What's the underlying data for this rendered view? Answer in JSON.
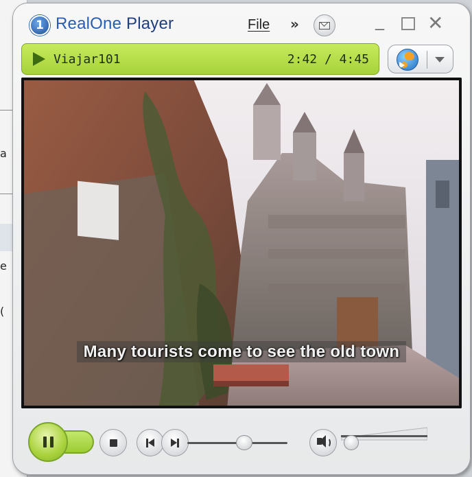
{
  "background_window": {
    "fragments": [
      "a",
      "e",
      "("
    ]
  },
  "player": {
    "title_brand": "RealOne",
    "title_rest": " Player",
    "logo_glyph": "1",
    "menu": {
      "file": "File",
      "more": "»"
    },
    "window_controls": {
      "minimize": "_",
      "close": "✕"
    }
  },
  "now_playing": {
    "clip_title": "Viajar101",
    "time": "2:42 / 4:45",
    "position_fraction": 0.5684
  },
  "video": {
    "subtitle": "Many tourists come to see the old town"
  },
  "controls": {
    "volume_fraction": 0.12
  },
  "colors": {
    "accent_green": "#a7d23a",
    "title_blue": "#1f3f7a"
  },
  "icons": [
    "realone-logo-icon",
    "play-icon",
    "message-icon",
    "media-globe-icon",
    "chevron-down-icon",
    "pause-icon",
    "stop-icon",
    "previous-icon",
    "next-icon",
    "volume-icon"
  ]
}
